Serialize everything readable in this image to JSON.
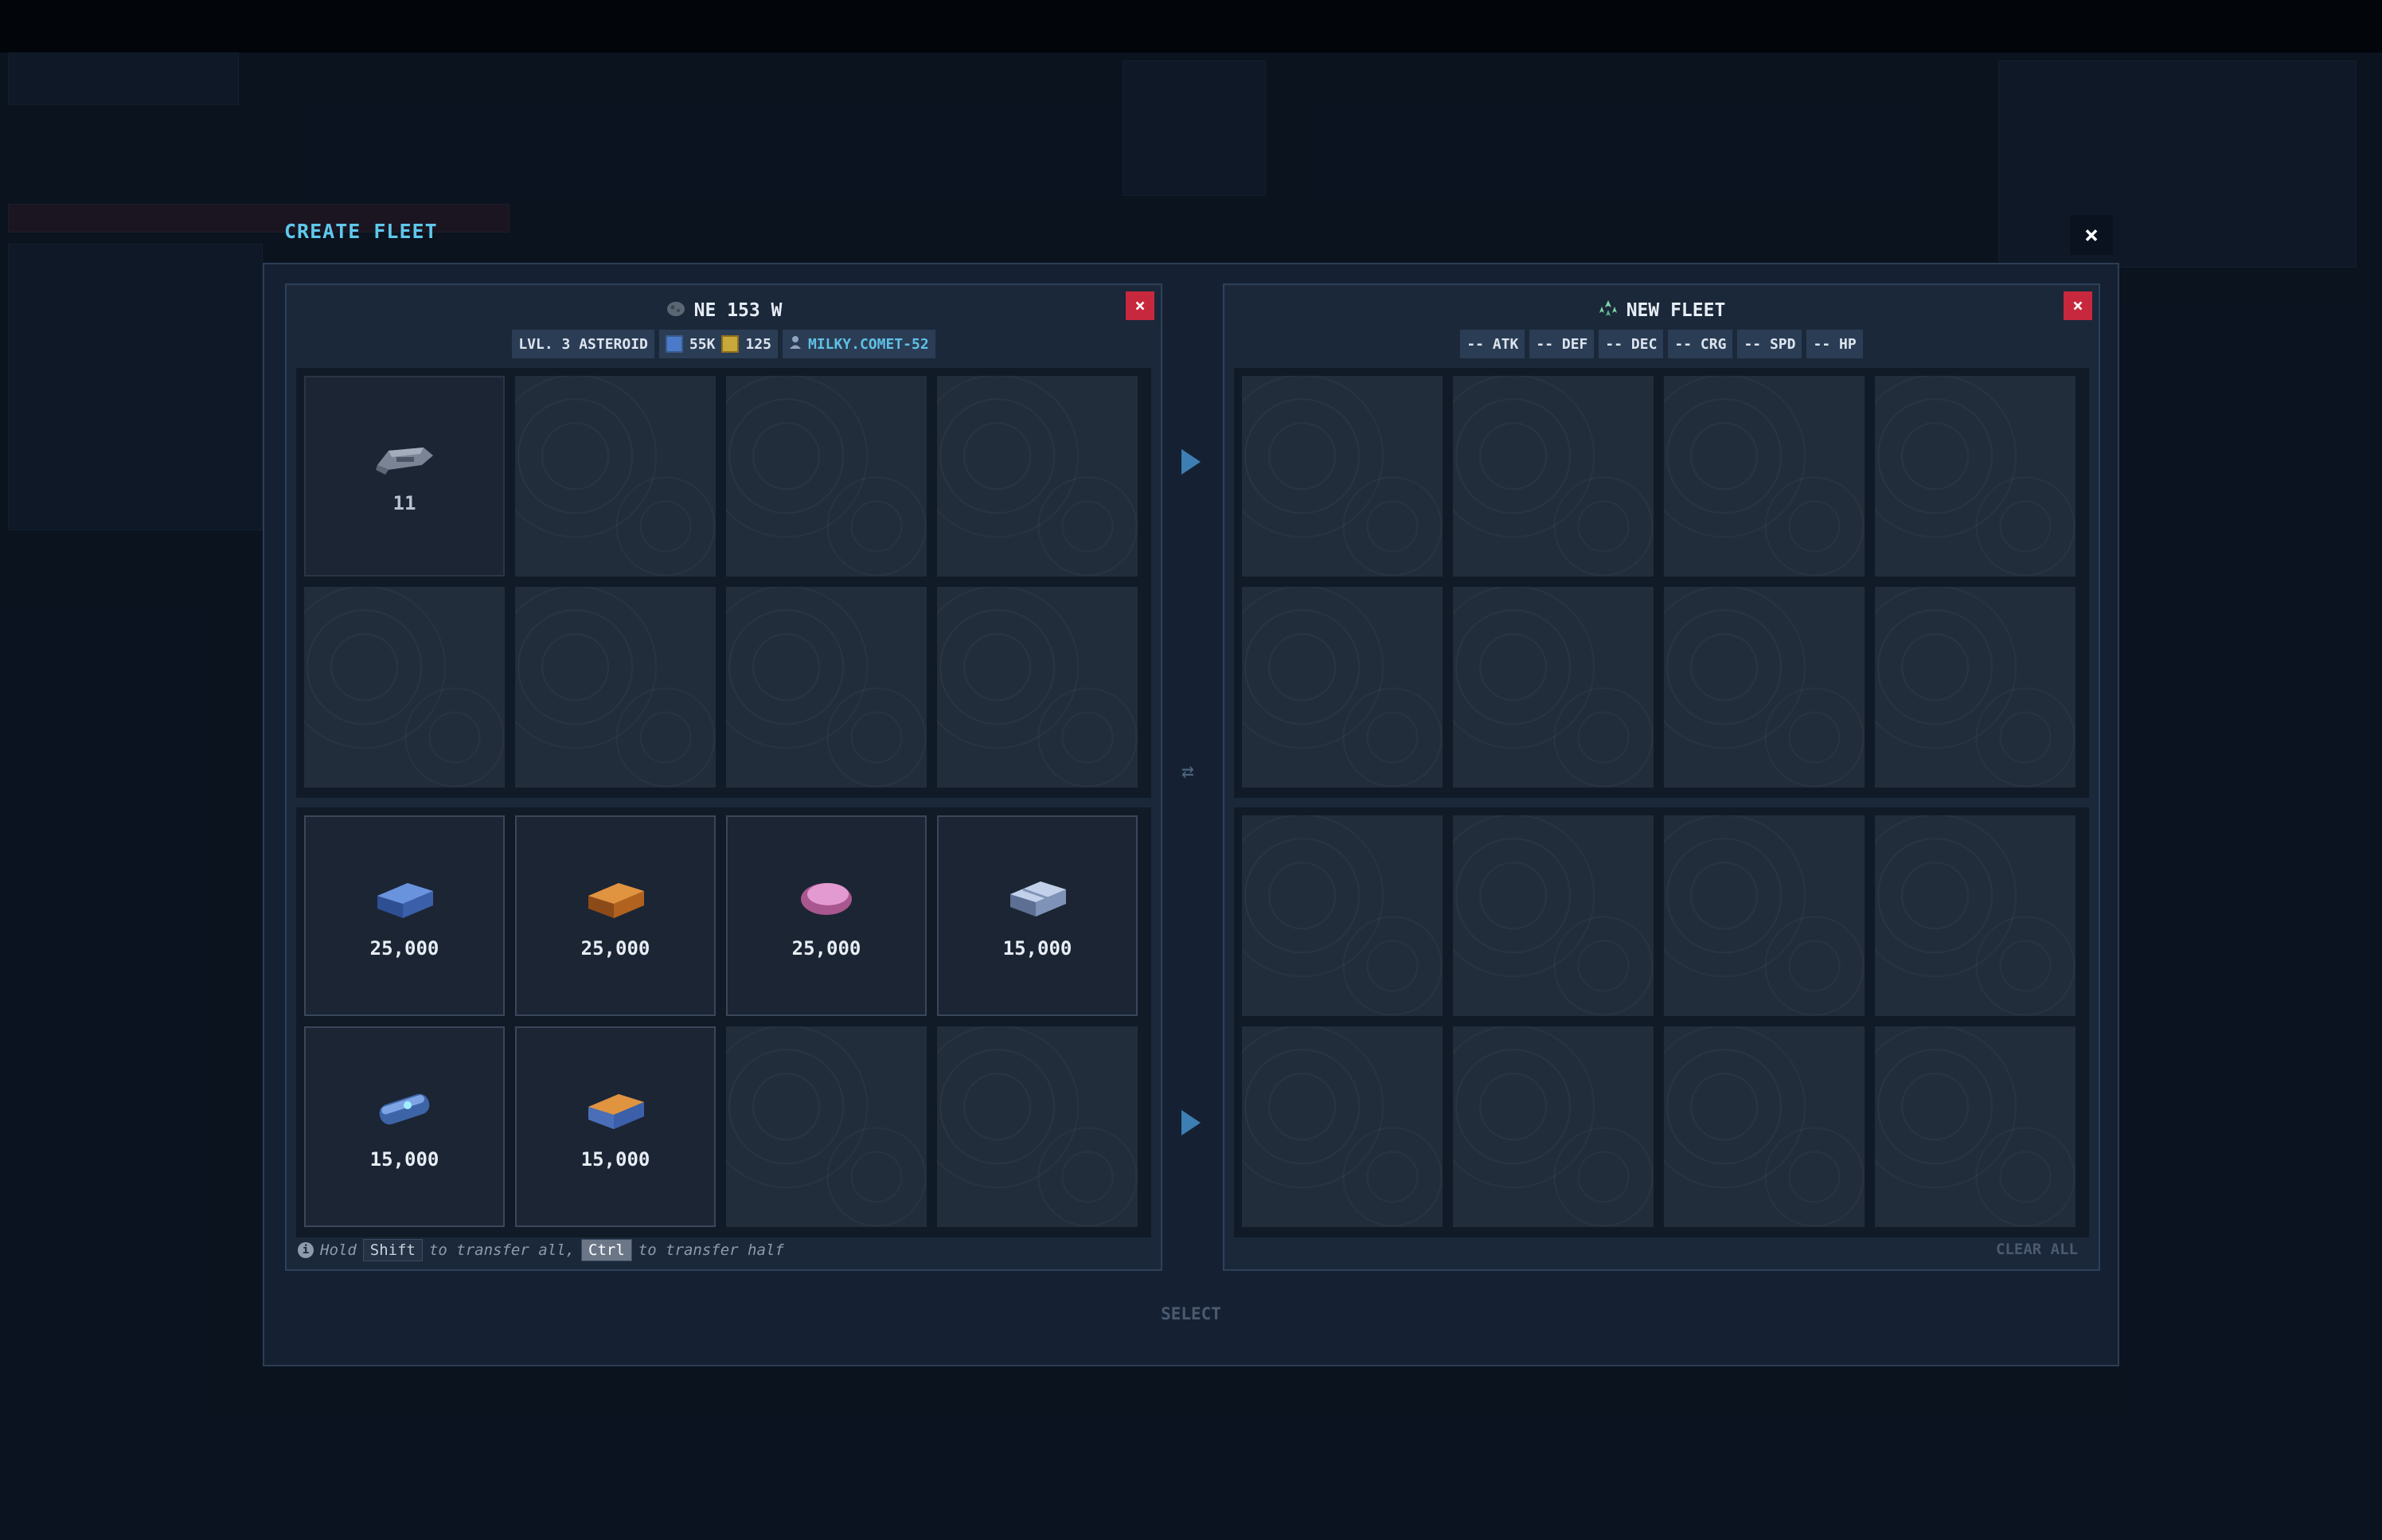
{
  "modal": {
    "title": "CREATE FLEET",
    "close": "×",
    "select_label": "SELECT"
  },
  "source_panel": {
    "name": "NE 153 W",
    "close": "×",
    "level_tag": "LVL. 3 ASTEROID",
    "resource_a": "55K",
    "resource_b": "125",
    "player": "MILKY.COMET-52",
    "ships": [
      {
        "icon": "ship-icon",
        "count": "11"
      }
    ],
    "resources": [
      {
        "icon": "blue-ingot-icon",
        "amount": "25,000",
        "color": "#4d74c4"
      },
      {
        "icon": "copper-ingot-icon",
        "amount": "25,000",
        "color": "#c4742a"
      },
      {
        "icon": "pink-crystal-icon",
        "amount": "25,000",
        "color": "#d886c2"
      },
      {
        "icon": "steel-plate-icon",
        "amount": "15,000",
        "color": "#a7b8d8"
      },
      {
        "icon": "blue-capsule-icon",
        "amount": "15,000",
        "color": "#5a8ad2"
      },
      {
        "icon": "hybrid-ingot-icon",
        "amount": "15,000",
        "color": "#d28a3a"
      }
    ],
    "hint": {
      "part1": "Hold",
      "key1": "Shift",
      "part2": "to transfer all,",
      "key2": "Ctrl",
      "part3": "to transfer half"
    }
  },
  "fleet_panel": {
    "name": "NEW FLEET",
    "close": "×",
    "stats": [
      "-- ATK",
      "-- DEF",
      "-- DEC",
      "-- CRG",
      "-- SPD",
      "-- HP"
    ],
    "clear_all": "CLEAR ALL"
  }
}
